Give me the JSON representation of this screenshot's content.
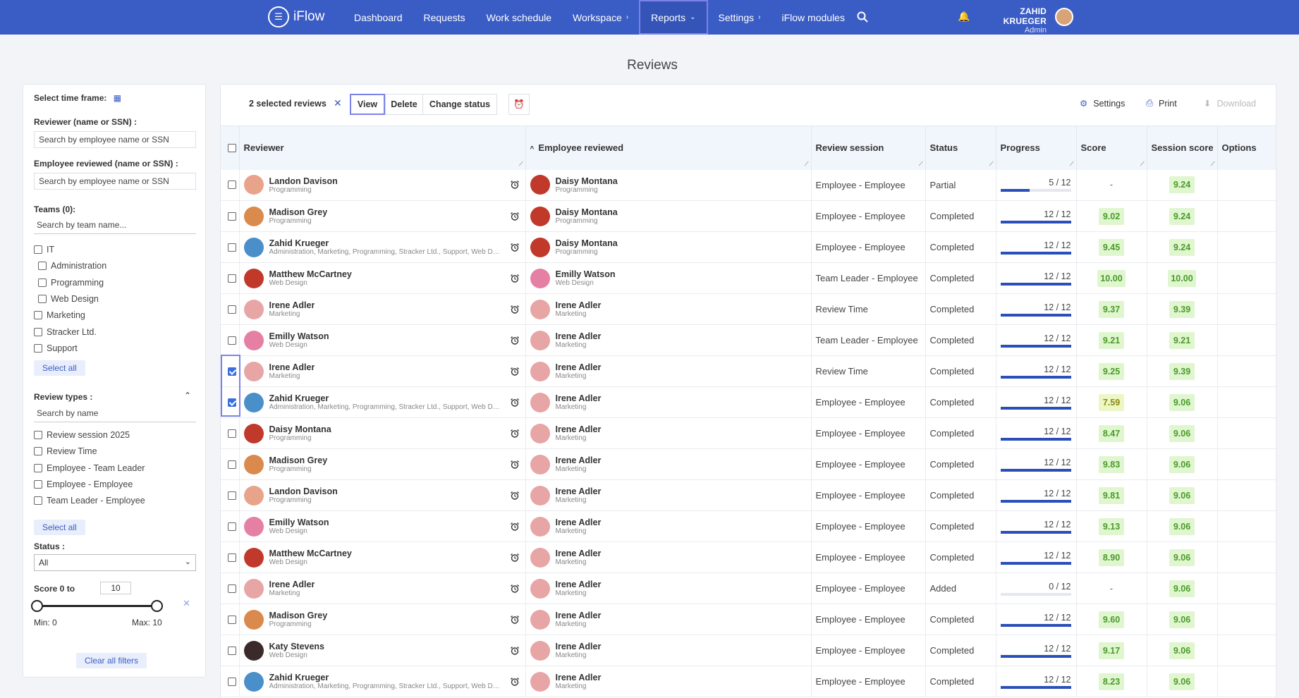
{
  "app": {
    "logo_text": "iFlow"
  },
  "nav": {
    "items": [
      {
        "label": "Dashboard",
        "chev": false,
        "active": false
      },
      {
        "label": "Requests",
        "chev": false,
        "active": false
      },
      {
        "label": "Work schedule",
        "chev": false,
        "active": false
      },
      {
        "label": "Workspace",
        "chev": true,
        "chev_char": "›",
        "active": false
      },
      {
        "label": "Reports",
        "chev": true,
        "chev_char": "⌄",
        "active": true
      },
      {
        "label": "Settings",
        "chev": true,
        "chev_char": "›",
        "active": false
      },
      {
        "label": "iFlow modules",
        "chev": false,
        "active": false
      }
    ],
    "user_name": "ZAHID KRUEGER",
    "user_role": "Admin"
  },
  "page_title": "Reviews",
  "filters": {
    "time_frame_label": "Select time frame:",
    "reviewer_label": "Reviewer (name or SSN) :",
    "reviewer_placeholder": "Search by employee name or SSN",
    "employee_label": "Employee reviewed (name or SSN) :",
    "employee_placeholder": "Search by employee name or SSN",
    "teams_label": "Teams (0):",
    "teams_placeholder": "Search by team name...",
    "teams": [
      {
        "label": "IT",
        "indent": false
      },
      {
        "label": "Administration",
        "indent": true
      },
      {
        "label": "Programming",
        "indent": true
      },
      {
        "label": "Web Design",
        "indent": true
      },
      {
        "label": "Marketing",
        "indent": false
      },
      {
        "label": "Stracker Ltd.",
        "indent": false
      },
      {
        "label": "Support",
        "indent": false
      }
    ],
    "select_all": "Select all",
    "review_types_label": "Review types :",
    "review_types_placeholder": "Search by name",
    "review_types": [
      "Review session 2025",
      "Review Time",
      "Employee - Team Leader",
      "Employee - Employee",
      "Team Leader - Employee"
    ],
    "status_label": "Status :",
    "status_value": "All",
    "score_label": "Score 0 to",
    "score_max_value": "10",
    "min_label": "Min: 0",
    "max_label": "Max: 10",
    "clear_all": "Clear all filters"
  },
  "toolbar": {
    "selected_text": "2 selected reviews",
    "view": "View",
    "delete": "Delete",
    "change_status": "Change status",
    "settings": "Settings",
    "print": "Print",
    "download": "Download"
  },
  "table": {
    "headers": {
      "reviewer": "Reviewer",
      "employee": "Employee reviewed",
      "session": "Review session",
      "status": "Status",
      "progress": "Progress",
      "score": "Score",
      "session_score": "Session score",
      "options": "Options"
    },
    "rows": [
      {
        "checked": false,
        "r_name": "Landon Davison",
        "r_team": "Programming",
        "r_color": "#e8a48a",
        "e_name": "Daisy Montana",
        "e_team": "Programming",
        "e_color": "#c0392b",
        "session": "Employee - Employee",
        "status": "Partial",
        "progress": "5 / 12",
        "pct": 0.4167,
        "score": "-",
        "score_cls": "none",
        "sscore": "9.24"
      },
      {
        "checked": false,
        "r_name": "Madison Grey",
        "r_team": "Programming",
        "r_color": "#d98a4c",
        "e_name": "Daisy Montana",
        "e_team": "Programming",
        "e_color": "#c0392b",
        "session": "Employee - Employee",
        "status": "Completed",
        "progress": "12 / 12",
        "pct": 1,
        "score": "9.02",
        "score_cls": "",
        "sscore": "9.24"
      },
      {
        "checked": false,
        "r_name": "Zahid Krueger",
        "r_team": "Administration, Marketing, Programming, Stracker Ltd., Support, Web Design",
        "r_color": "#4a8fc9",
        "e_name": "Daisy Montana",
        "e_team": "Programming",
        "e_color": "#c0392b",
        "session": "Employee - Employee",
        "status": "Completed",
        "progress": "12 / 12",
        "pct": 1,
        "score": "9.45",
        "score_cls": "",
        "sscore": "9.24"
      },
      {
        "checked": false,
        "r_name": "Matthew McCartney",
        "r_team": "Web Design",
        "r_color": "#c0392b",
        "e_name": "Emilly Watson",
        "e_team": "Web Design",
        "e_color": "#e57fa3",
        "session": "Team Leader - Employee",
        "status": "Completed",
        "progress": "12 / 12",
        "pct": 1,
        "score": "10.00",
        "score_cls": "",
        "sscore": "10.00"
      },
      {
        "checked": false,
        "r_name": "Irene Adler",
        "r_team": "Marketing",
        "r_color": "#e8a5a5",
        "e_name": "Irene Adler",
        "e_team": "Marketing",
        "e_color": "#e8a5a5",
        "session": "Review Time",
        "status": "Completed",
        "progress": "12 / 12",
        "pct": 1,
        "score": "9.37",
        "score_cls": "",
        "sscore": "9.39"
      },
      {
        "checked": false,
        "r_name": "Emilly Watson",
        "r_team": "Web Design",
        "r_color": "#e57fa3",
        "e_name": "Irene Adler",
        "e_team": "Marketing",
        "e_color": "#e8a5a5",
        "session": "Team Leader - Employee",
        "status": "Completed",
        "progress": "12 / 12",
        "pct": 1,
        "score": "9.21",
        "score_cls": "",
        "sscore": "9.21"
      },
      {
        "checked": true,
        "r_name": "Irene Adler",
        "r_team": "Marketing",
        "r_color": "#e8a5a5",
        "e_name": "Irene Adler",
        "e_team": "Marketing",
        "e_color": "#e8a5a5",
        "session": "Review Time",
        "status": "Completed",
        "progress": "12 / 12",
        "pct": 1,
        "score": "9.25",
        "score_cls": "",
        "sscore": "9.39"
      },
      {
        "checked": true,
        "r_name": "Zahid Krueger",
        "r_team": "Administration, Marketing, Programming, Stracker Ltd., Support, Web Design",
        "r_color": "#4a8fc9",
        "e_name": "Irene Adler",
        "e_team": "Marketing",
        "e_color": "#e8a5a5",
        "session": "Employee - Employee",
        "status": "Completed",
        "progress": "12 / 12",
        "pct": 1,
        "score": "7.59",
        "score_cls": "mid",
        "sscore": "9.06"
      },
      {
        "checked": false,
        "r_name": "Daisy Montana",
        "r_team": "Programming",
        "r_color": "#c0392b",
        "e_name": "Irene Adler",
        "e_team": "Marketing",
        "e_color": "#e8a5a5",
        "session": "Employee - Employee",
        "status": "Completed",
        "progress": "12 / 12",
        "pct": 1,
        "score": "8.47",
        "score_cls": "",
        "sscore": "9.06"
      },
      {
        "checked": false,
        "r_name": "Madison Grey",
        "r_team": "Programming",
        "r_color": "#d98a4c",
        "e_name": "Irene Adler",
        "e_team": "Marketing",
        "e_color": "#e8a5a5",
        "session": "Employee - Employee",
        "status": "Completed",
        "progress": "12 / 12",
        "pct": 1,
        "score": "9.83",
        "score_cls": "",
        "sscore": "9.06"
      },
      {
        "checked": false,
        "r_name": "Landon Davison",
        "r_team": "Programming",
        "r_color": "#e8a48a",
        "e_name": "Irene Adler",
        "e_team": "Marketing",
        "e_color": "#e8a5a5",
        "session": "Employee - Employee",
        "status": "Completed",
        "progress": "12 / 12",
        "pct": 1,
        "score": "9.81",
        "score_cls": "",
        "sscore": "9.06"
      },
      {
        "checked": false,
        "r_name": "Emilly Watson",
        "r_team": "Web Design",
        "r_color": "#e57fa3",
        "e_name": "Irene Adler",
        "e_team": "Marketing",
        "e_color": "#e8a5a5",
        "session": "Employee - Employee",
        "status": "Completed",
        "progress": "12 / 12",
        "pct": 1,
        "score": "9.13",
        "score_cls": "",
        "sscore": "9.06"
      },
      {
        "checked": false,
        "r_name": "Matthew McCartney",
        "r_team": "Web Design",
        "r_color": "#c0392b",
        "e_name": "Irene Adler",
        "e_team": "Marketing",
        "e_color": "#e8a5a5",
        "session": "Employee - Employee",
        "status": "Completed",
        "progress": "12 / 12",
        "pct": 1,
        "score": "8.90",
        "score_cls": "",
        "sscore": "9.06"
      },
      {
        "checked": false,
        "r_name": "Irene Adler",
        "r_team": "Marketing",
        "r_color": "#e8a5a5",
        "e_name": "Irene Adler",
        "e_team": "Marketing",
        "e_color": "#e8a5a5",
        "session": "Employee - Employee",
        "status": "Added",
        "progress": "0 / 12",
        "pct": 0,
        "score": "-",
        "score_cls": "none",
        "sscore": "9.06"
      },
      {
        "checked": false,
        "r_name": "Madison Grey",
        "r_team": "Programming",
        "r_color": "#d98a4c",
        "e_name": "Irene Adler",
        "e_team": "Marketing",
        "e_color": "#e8a5a5",
        "session": "Employee - Employee",
        "status": "Completed",
        "progress": "12 / 12",
        "pct": 1,
        "score": "9.60",
        "score_cls": "",
        "sscore": "9.06"
      },
      {
        "checked": false,
        "r_name": "Katy Stevens",
        "r_team": "Web Design",
        "r_color": "#3a2a2a",
        "e_name": "Irene Adler",
        "e_team": "Marketing",
        "e_color": "#e8a5a5",
        "session": "Employee - Employee",
        "status": "Completed",
        "progress": "12 / 12",
        "pct": 1,
        "score": "9.17",
        "score_cls": "",
        "sscore": "9.06"
      },
      {
        "checked": false,
        "r_name": "Zahid Krueger",
        "r_team": "Administration, Marketing, Programming, Stracker Ltd., Support, Web Design",
        "r_color": "#4a8fc9",
        "e_name": "Irene Adler",
        "e_team": "Marketing",
        "e_color": "#e8a5a5",
        "session": "Employee - Employee",
        "status": "Completed",
        "progress": "12 / 12",
        "pct": 1,
        "score": "8.23",
        "score_cls": "",
        "sscore": "9.06"
      }
    ]
  }
}
